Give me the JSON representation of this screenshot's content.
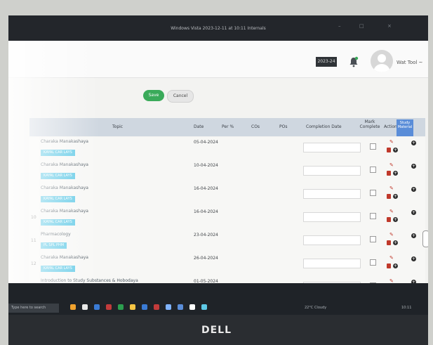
{
  "window": {
    "title": "Windows Vista 2023-12-11 at 10:11 Internals"
  },
  "header": {
    "credit_badge": "2023-24",
    "user_name": "Wat Tool ~"
  },
  "form_actions": {
    "save": "Save",
    "cancel": "Cancel"
  },
  "table": {
    "columns": [
      "Topic",
      "Date",
      "Per %",
      "COs",
      "POs",
      "Completion Date",
      "Mark Complete",
      "Action",
      "Study Material"
    ],
    "rows": [
      {
        "sno": "",
        "topic": "Charaka Manakashaya",
        "tag": "KAYAL CAR LAYS",
        "date": "05-04-2024"
      },
      {
        "sno": "",
        "topic": "Charaka Manakashaya",
        "tag": "KAYAL CAR LAYS",
        "date": "10-04-2024"
      },
      {
        "sno": "",
        "topic": "Charaka Manakashaya",
        "tag": "KAYAL CAR LAYS",
        "date": "16-04-2024"
      },
      {
        "sno": "10",
        "topic": "Charaka Manakashaya",
        "tag": "KAYAL CAR LAYS",
        "date": "16-04-2024"
      },
      {
        "sno": "11",
        "topic": "Pharmacology",
        "tag": "PL SPL PHM",
        "date": "23-04-2024"
      },
      {
        "sno": "12",
        "topic": "Charaka Manakashaya",
        "tag": "KAYAL CAR LAYS",
        "date": "26-04-2024"
      },
      {
        "sno": "13",
        "topic": "Introduction to Study Substances & Hobodaya",
        "tag": "",
        "date": "01-05-2024"
      }
    ]
  },
  "taskbar": {
    "search": "Type here to search",
    "weather": "22°C Cloudy",
    "time": "10:11"
  },
  "brand": "DELL",
  "colors": {
    "save": "#3aaa5a",
    "tag": "#5ec9e6",
    "study_header": "#5a8dd8",
    "action_delete": "#c0392b"
  }
}
